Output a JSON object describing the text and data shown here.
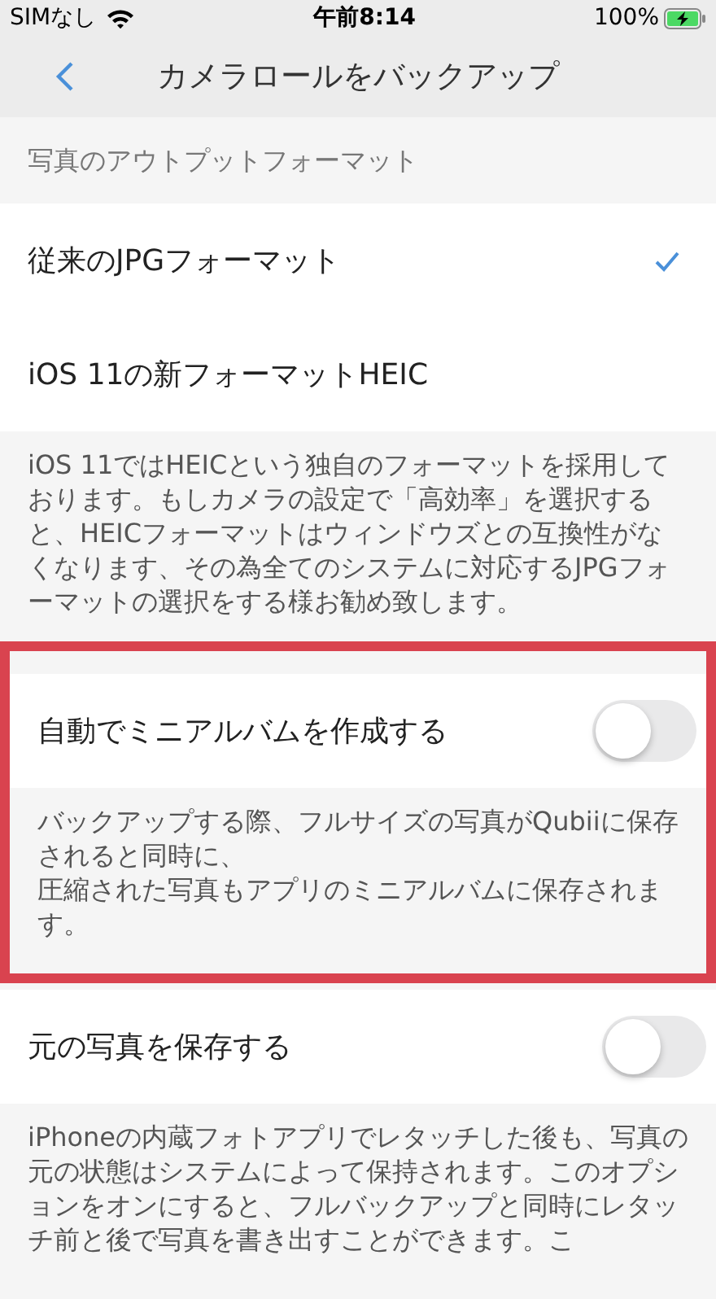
{
  "status_bar": {
    "carrier": "SIMなし",
    "time": "午前8:14",
    "battery": "100%"
  },
  "nav": {
    "title": "カメラロールをバックアップ"
  },
  "format_section": {
    "header": "写真のアウトプットフォーマット",
    "options": [
      {
        "label": "従来のJPGフォーマット",
        "selected": true
      },
      {
        "label": "iOS 11の新フォーマットHEIC",
        "selected": false
      }
    ],
    "description": "iOS 11ではHEICという独自のフォーマットを採用しております。もしカメラの設定で「高効率」を選択すると、HEICフォーマットはウィンドウズとの互換性がなくなります、その為全てのシステムに対応するJPGフォーマットの選択をする様お勧め致します。"
  },
  "settings": [
    {
      "label": "自動でミニアルバムを作成する",
      "on": false,
      "highlighted": true,
      "description": [
        "バックアップする際、フルサイズの写真がQubiiに保存されると同時に、",
        "圧縮された写真もアプリのミニアルバムに保存されます。"
      ]
    },
    {
      "label": "元の写真を保存する",
      "on": false,
      "highlighted": false,
      "description": [
        "iPhoneの内蔵フォトアプリでレタッチした後も、写真の元の状態はシステムによって保持されます。このオプションをオンにすると、フルバックアップと同時にレタッチ前と後で写真を書き出すことができます。こ"
      ]
    }
  ]
}
